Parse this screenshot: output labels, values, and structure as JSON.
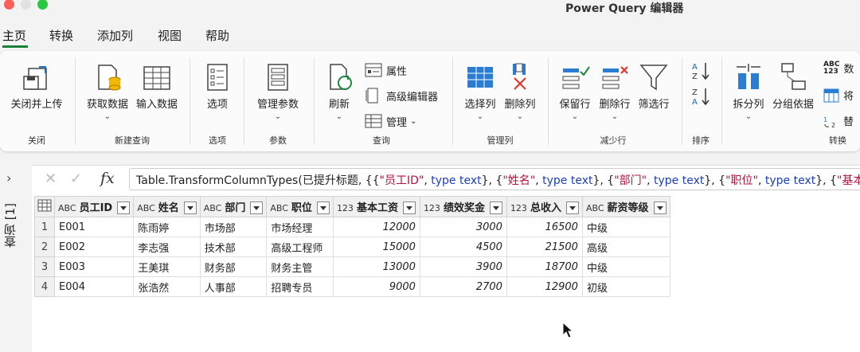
{
  "window": {
    "title": "Power Query 编辑器"
  },
  "tabs": [
    {
      "label": "主页"
    },
    {
      "label": "转换"
    },
    {
      "label": "添加列"
    },
    {
      "label": "视图"
    },
    {
      "label": "帮助"
    }
  ],
  "ribbon": {
    "close_group": {
      "close_upload": "关闭并上传",
      "label": "关闭"
    },
    "new_query_group": {
      "get_data": "获取数据",
      "enter_data": "输入数据",
      "label": "新建查询"
    },
    "options_group": {
      "options": "选项",
      "label": "选项"
    },
    "params_group": {
      "manage_params": "管理参数",
      "label": "参数"
    },
    "query_group": {
      "refresh": "刷新",
      "properties": "属性",
      "advanced_editor": "高级编辑器",
      "manage": "管理",
      "label": "查询"
    },
    "manage_cols_group": {
      "choose_cols": "选择列",
      "remove_cols": "删除列",
      "label": "管理列"
    },
    "reduce_rows_group": {
      "keep_rows": "保留行",
      "remove_rows": "删除行",
      "filter_rows": "筛选行",
      "label": "减少行"
    },
    "sort_group": {
      "label": "排序"
    },
    "transform_group": {
      "split_col": "拆分列",
      "group_by": "分组依据",
      "data_type": "数",
      "use_first": "将",
      "replace": "替",
      "label": "转换",
      "abc123": "ABC\n123"
    }
  },
  "left_pane": {
    "label": "查询 [1]"
  },
  "formula_bar": {
    "cancel": "✕",
    "confirm": "✓",
    "fx": "fx",
    "p1": "Table.TransformColumnTypes(已提升标题, {{",
    "s1": "\"员工ID\"",
    "c1": ", ",
    "t1": "type text",
    "p2": "}, {",
    "s2": "\"姓名\"",
    "c2": ", ",
    "t2": "type text",
    "p3": "}, {",
    "s3": "\"部门\"",
    "c3": ", ",
    "t3": "type text",
    "p4": "}, {",
    "s4": "\"职位\"",
    "c4": ", ",
    "t4": "type text",
    "p5": "}, {",
    "s5": "\"基本工资"
  },
  "table": {
    "columns": [
      {
        "type": "ABC",
        "name": "员工ID"
      },
      {
        "type": "ABC",
        "name": "姓名"
      },
      {
        "type": "ABC",
        "name": "部门"
      },
      {
        "type": "ABC",
        "name": "职位"
      },
      {
        "type": "123",
        "name": "基本工资"
      },
      {
        "type": "123",
        "name": "绩效奖金"
      },
      {
        "type": "123",
        "name": "总收入"
      },
      {
        "type": "ABC",
        "name": "薪资等级"
      }
    ],
    "rows": [
      [
        "1",
        "E001",
        "陈雨婷",
        "市场部",
        "市场经理",
        "12000",
        "3000",
        "16500",
        "中级"
      ],
      [
        "2",
        "E002",
        "李志强",
        "技术部",
        "高级工程师",
        "15000",
        "4500",
        "21500",
        "高级"
      ],
      [
        "3",
        "E003",
        "王美琪",
        "财务部",
        "财务主管",
        "13000",
        "3900",
        "18700",
        "中级"
      ],
      [
        "4",
        "E004",
        "张浩然",
        "人事部",
        "招聘专员",
        "9000",
        "2700",
        "12900",
        "初级"
      ]
    ]
  }
}
